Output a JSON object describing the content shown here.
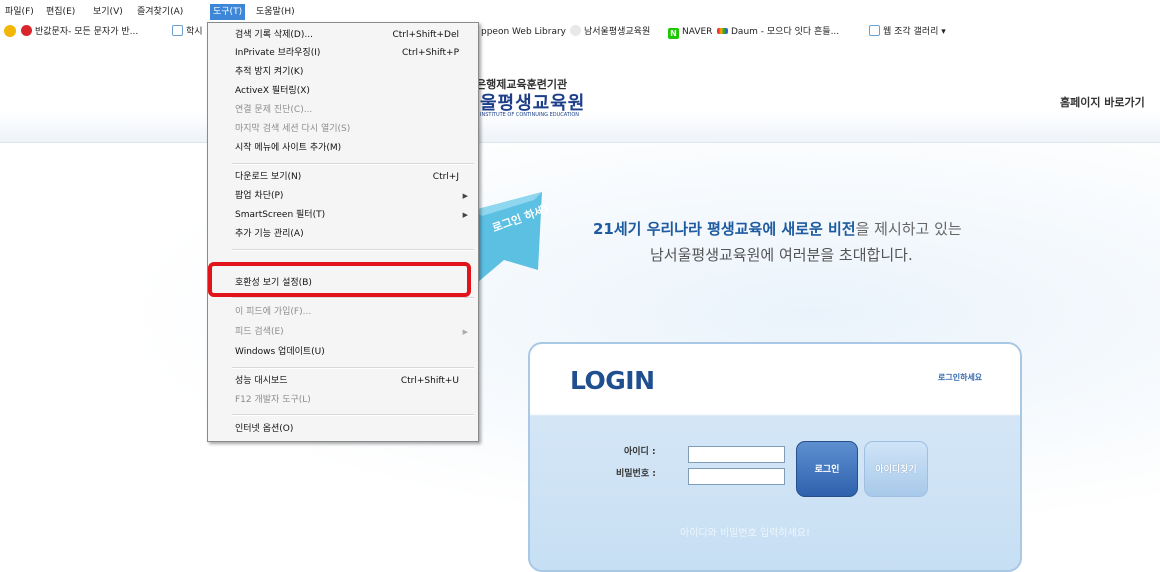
{
  "menubar": {
    "items": [
      "파일(F)",
      "편집(E)",
      "보기(V)",
      "즐겨찾기(A)",
      "도구(T)",
      "도움말(H)"
    ]
  },
  "favorites": {
    "items": [
      "반값문자- 모든 문자가 반...",
      "학시",
      "ppeon Web Library",
      "남서울평생교육원",
      "NAVER",
      "Daum - 모으다 잇다 흔들...",
      "웹 조각 갤러리 ▾"
    ]
  },
  "header": {
    "logo_top": "은행제교육훈련기관",
    "logo_main": "울평생교육원",
    "logo_sub": "INSTITUTE OF CONTINUING EDUCATION",
    "home_link": "홈페이지 바로가기"
  },
  "ribbon": {
    "text": "로그인 하세요"
  },
  "welcome": {
    "line1_highlight": "21세기 우리나라 평생교육에 새로운 비전",
    "line1_rest": "을 제시하고 있는",
    "line2": "남서울평생교육원에 여러분을 초대합니다."
  },
  "login": {
    "title": "LOGIN",
    "hint": "로그인하세요",
    "id_label": "아이디 :",
    "pw_label": "비밀번호 :",
    "login_button": "로그인",
    "find_button": "아이디찾기",
    "message": "아이디와 비밀번호 입력하세요!"
  },
  "dropdown": {
    "items": [
      {
        "label": "검색 기록 삭제(D)...",
        "shortcut": "Ctrl+Shift+Del",
        "disabled": false
      },
      {
        "label": "InPrivate 브라우징(I)",
        "shortcut": "Ctrl+Shift+P",
        "disabled": false
      },
      {
        "label": "추적 방지 켜기(K)",
        "shortcut": "",
        "disabled": false
      },
      {
        "label": "ActiveX 필터링(X)",
        "shortcut": "",
        "disabled": false
      },
      {
        "label": "연결 문제 진단(C)...",
        "shortcut": "",
        "disabled": true
      },
      {
        "label": "마지막 검색 세션 다시 열기(S)",
        "shortcut": "",
        "disabled": true
      },
      {
        "label": "시작 메뉴에 사이트 추가(M)",
        "shortcut": "",
        "disabled": false
      },
      {
        "label": "다운로드 보기(N)",
        "shortcut": "Ctrl+J",
        "disabled": false
      },
      {
        "label": "팝업 차단(P)",
        "shortcut": "",
        "disabled": false
      },
      {
        "label": "SmartScreen 필터(T)",
        "shortcut": "",
        "disabled": false
      },
      {
        "label": "추가 기능 관리(A)",
        "shortcut": "",
        "disabled": false
      },
      {
        "label": "호환성 보기 설정(B)",
        "shortcut": "",
        "disabled": false
      },
      {
        "label": "이 피드에 가입(F)...",
        "shortcut": "",
        "disabled": true
      },
      {
        "label": "피드 검색(E)",
        "shortcut": "",
        "disabled": true
      },
      {
        "label": "Windows 업데이트(U)",
        "shortcut": "",
        "disabled": false
      },
      {
        "label": "성능 대시보드",
        "shortcut": "Ctrl+Shift+U",
        "disabled": false
      },
      {
        "label": "F12 개발자 도구(L)",
        "shortcut": "",
        "disabled": true
      },
      {
        "label": "인터넷 옵션(O)",
        "shortcut": "",
        "disabled": false
      }
    ]
  },
  "colors": {
    "menu_highlight": "#3d86d8",
    "annotation_red": "#e0141a",
    "brand_blue": "#1d3f8a",
    "ribbon_teal": "#4fb3d9"
  }
}
